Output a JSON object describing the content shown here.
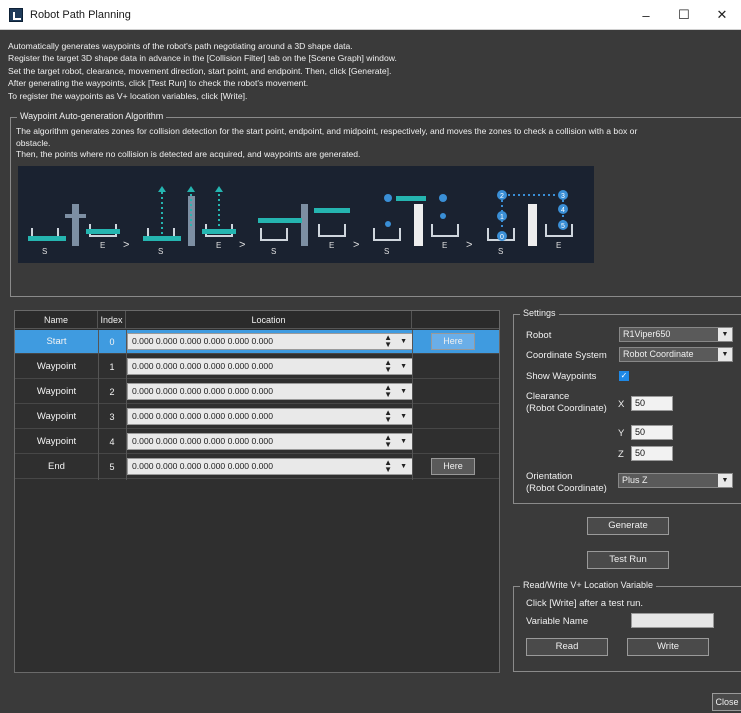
{
  "window": {
    "title": "Robot Path Planning",
    "controls": {
      "minimize": "–",
      "maximize": "☐",
      "close": "✕"
    }
  },
  "intro_lines": [
    "Automatically generates waypoints of the robot's path negotiating around a 3D shape data.",
    "Register the target 3D shape data in advance in the [Collision Filter] tab on the [Scene Graph] window.",
    "Set the target robot, clearance, movement direction, start point, and endpoint. Then, click [Generate].",
    "After generating the waypoints, click [Test Run] to check the robot's movement.",
    "To register the waypoints as V+ location variables, click [Write]."
  ],
  "algorithm": {
    "legend": "Waypoint Auto-generation Algorithm",
    "lines": [
      "The algorithm generates zones for collision detection for the start point, endpoint, and midpoint, respectively, and moves the zones to check a collision with a box or",
      "obstacle.",
      "Then, the points where no collision is detected are acquired, and waypoints are generated."
    ],
    "figure": {
      "start_label": "S",
      "end_label": "E",
      "separator": ">",
      "point_numbers": [
        "0",
        "1",
        "2",
        "3",
        "4",
        "5"
      ]
    }
  },
  "grid": {
    "headers": {
      "name": "Name",
      "index": "Index",
      "location": "Location",
      "action": ""
    },
    "here_label": "Here",
    "rows": [
      {
        "name": "Start",
        "index": "0",
        "location": "0.000 0.000 0.000 0.000 0.000 0.000",
        "has_here": true,
        "selected": true
      },
      {
        "name": "Waypoint",
        "index": "1",
        "location": "0.000 0.000 0.000 0.000 0.000 0.000",
        "has_here": false,
        "selected": false
      },
      {
        "name": "Waypoint",
        "index": "2",
        "location": "0.000 0.000 0.000 0.000 0.000 0.000",
        "has_here": false,
        "selected": false
      },
      {
        "name": "Waypoint",
        "index": "3",
        "location": "0.000 0.000 0.000 0.000 0.000 0.000",
        "has_here": false,
        "selected": false
      },
      {
        "name": "Waypoint",
        "index": "4",
        "location": "0.000 0.000 0.000 0.000 0.000 0.000",
        "has_here": false,
        "selected": false
      },
      {
        "name": "End",
        "index": "5",
        "location": "0.000 0.000 0.000 0.000 0.000 0.000",
        "has_here": true,
        "selected": false
      }
    ]
  },
  "settings": {
    "legend": "Settings",
    "robot_label": "Robot",
    "robot_value": "R1Viper650",
    "coord_label": "Coordinate System",
    "coord_value": "Robot Coordinate",
    "show_waypoints_label": "Show Waypoints",
    "show_waypoints_checked": true,
    "clearance_label_1": "Clearance",
    "clearance_label_2": "(Robot Coordinate)",
    "x_label": "X",
    "x_value": "50",
    "y_label": "Y",
    "y_value": "50",
    "z_label": "Z",
    "z_value": "50",
    "orientation_label_1": "Orientation",
    "orientation_label_2": "(Robot Coordinate)",
    "orientation_value": "Plus Z"
  },
  "actions": {
    "generate": "Generate",
    "test_run": "Test Run"
  },
  "readwrite": {
    "legend": "Read/Write V+ Location Variable",
    "hint": "Click [Write] after a test run.",
    "variable_label": "Variable Name",
    "variable_value": "",
    "read": "Read",
    "write": "Write"
  },
  "close_button": "Close",
  "colors": {
    "background": "#3a3a3a",
    "selection": "#3f9be0",
    "teal": "#25b5b0",
    "marker_blue": "#3a8fd6",
    "figure_bg": "#1a2230"
  }
}
